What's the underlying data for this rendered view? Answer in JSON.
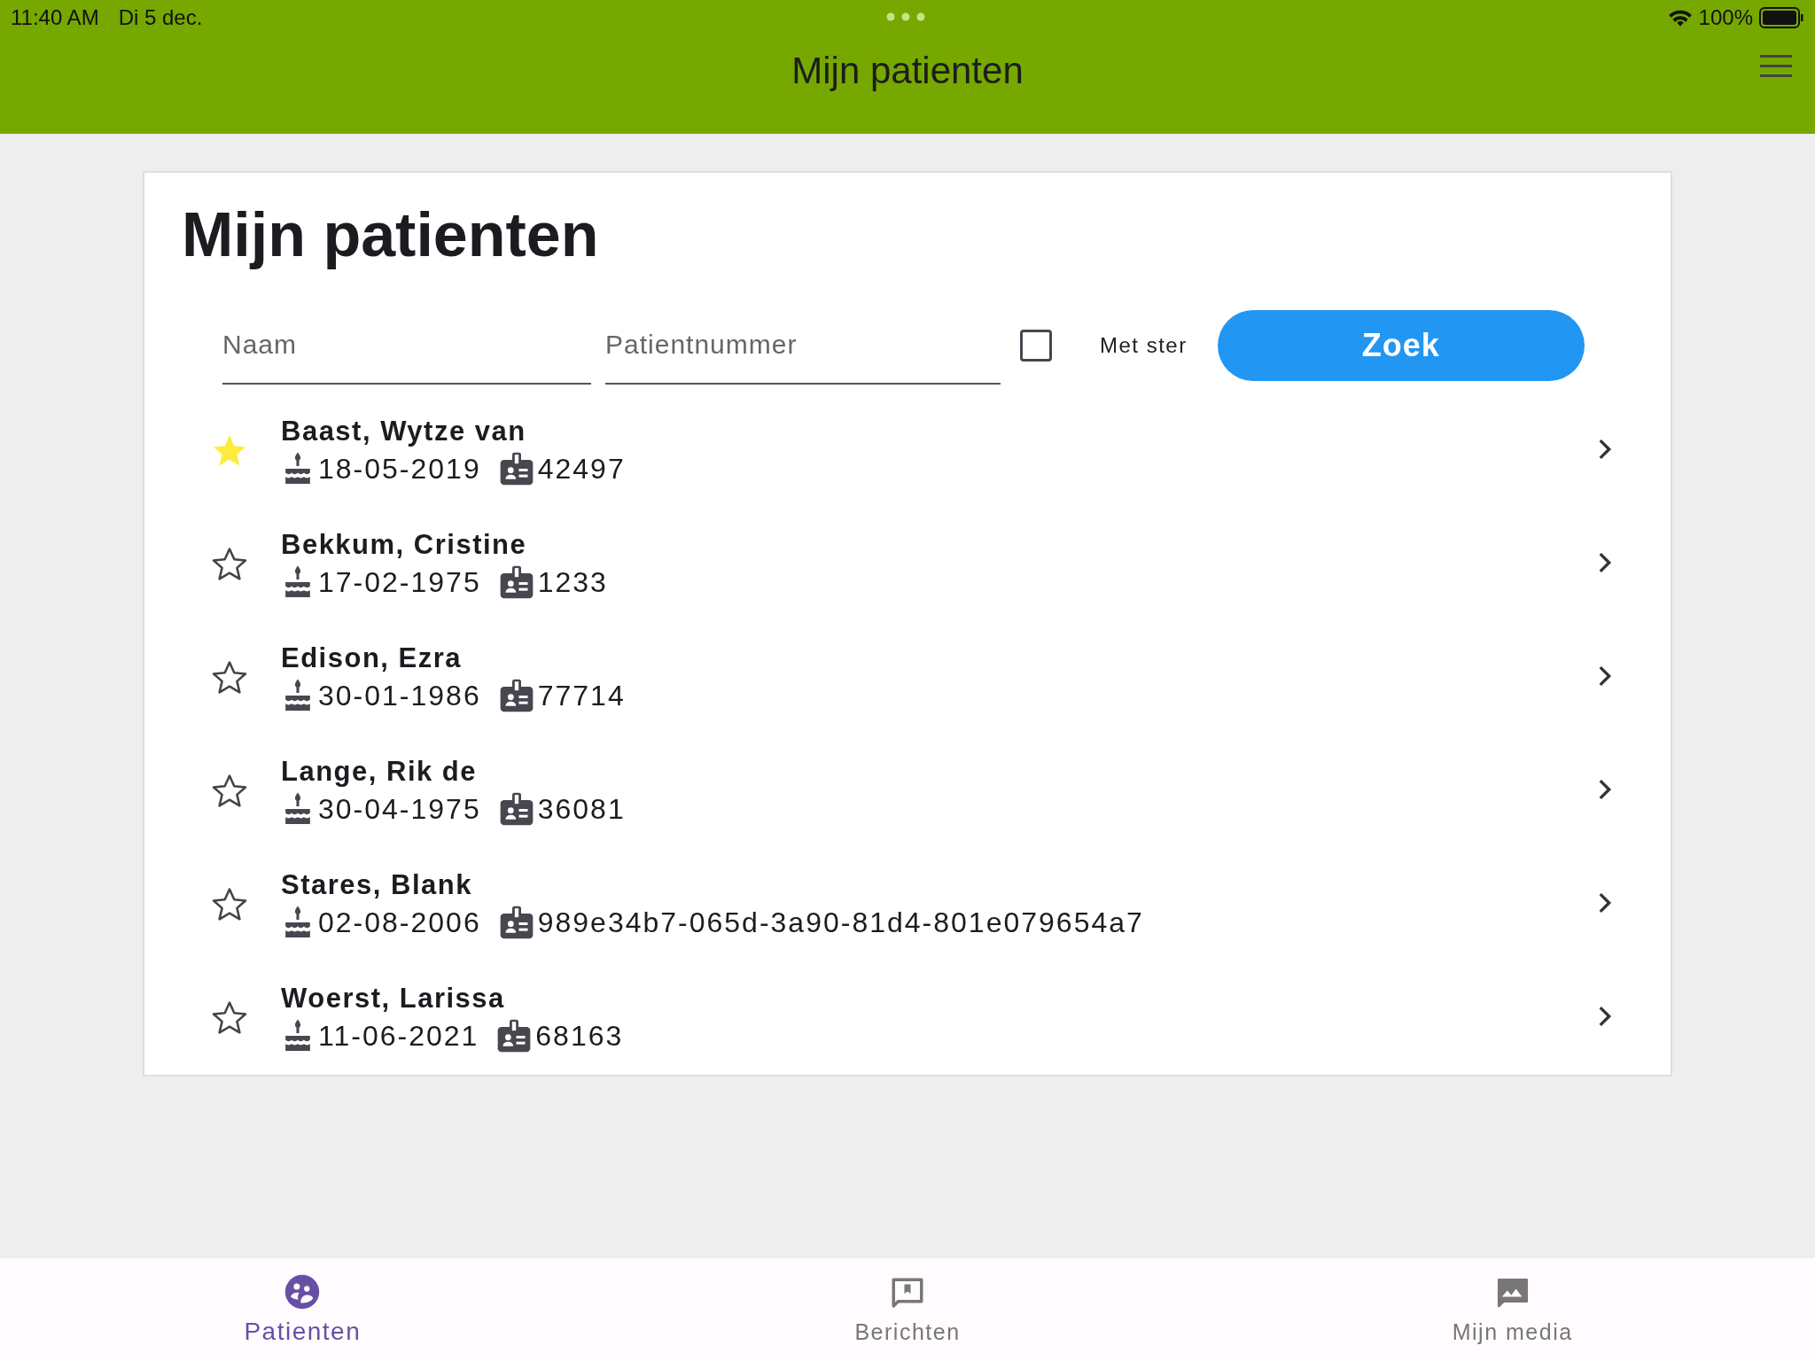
{
  "status_bar": {
    "time": "11:40 AM",
    "date": "Di 5 dec.",
    "battery": "100%"
  },
  "header": {
    "title": "Mijn patienten"
  },
  "page": {
    "heading": "Mijn patienten"
  },
  "search": {
    "name_placeholder": "Naam",
    "number_placeholder": "Patientnummer",
    "starred_only": {
      "label": "Met ster",
      "checked": false
    },
    "button": "Zoek"
  },
  "patients": [
    {
      "name": "Baast, Wytze van",
      "birth_date": "18-05-2019",
      "number": "42497",
      "starred": true
    },
    {
      "name": "Bekkum, Cristine",
      "birth_date": "17-02-1975",
      "number": "1233",
      "starred": false
    },
    {
      "name": "Edison, Ezra",
      "birth_date": "30-01-1986",
      "number": "77714",
      "starred": false
    },
    {
      "name": "Lange, Rik de",
      "birth_date": "30-04-1975",
      "number": "36081",
      "starred": false
    },
    {
      "name": "Stares, Blank",
      "birth_date": "02-08-2006",
      "number": "989e34b7-065d-3a90-81d4-801e079654a7",
      "starred": false
    },
    {
      "name": "Woerst, Larissa",
      "birth_date": "11-06-2021",
      "number": "68163",
      "starred": false
    }
  ],
  "tabs": [
    {
      "label": "Patienten",
      "selected": true,
      "kind": "patients"
    },
    {
      "label": "Berichten",
      "selected": false,
      "kind": "messages"
    },
    {
      "label": "Mijn media",
      "selected": false,
      "kind": "media"
    }
  ]
}
